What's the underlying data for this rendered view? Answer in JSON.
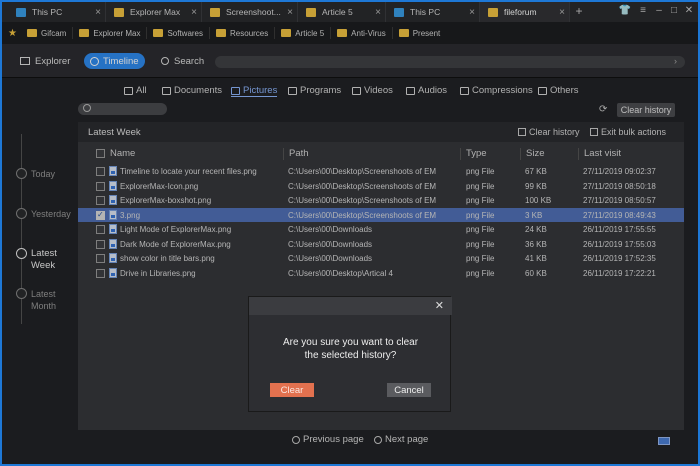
{
  "tabs": [
    {
      "label": "This PC",
      "icon": "pc-icon",
      "active": false
    },
    {
      "label": "Explorer Max",
      "icon": "folder-icon",
      "active": false
    },
    {
      "label": "Screenshoot...",
      "icon": "folder-icon",
      "active": false
    },
    {
      "label": "Article 5",
      "icon": "folder-icon",
      "active": false
    },
    {
      "label": "This PC",
      "icon": "pc-icon",
      "active": false
    },
    {
      "label": "fileforum",
      "icon": "folder-icon",
      "active": true
    }
  ],
  "tab_close": "×",
  "tab_add": "+",
  "window_controls": {
    "skin": "👕",
    "menu": "≡",
    "minimize": "–",
    "maximize": "□",
    "close": "✕"
  },
  "bookmarks": [
    "Gifcam",
    "Explorer Max",
    "Softwares",
    "Resources",
    "Article 5",
    "Anti-Virus",
    "Present"
  ],
  "nav": {
    "explorer": "Explorer",
    "timeline": "Timeline",
    "search": "Search"
  },
  "timeline": {
    "items": [
      {
        "label": "Today",
        "selected": false
      },
      {
        "label": "Yesterday",
        "selected": false
      },
      {
        "label": "Latest Week",
        "selected": true
      },
      {
        "label": "Latest Month",
        "selected": false
      }
    ]
  },
  "categories": [
    "All",
    "Documents",
    "Pictures",
    "Programs",
    "Videos",
    "Audios",
    "Compressions",
    "Others"
  ],
  "active_category": "Pictures",
  "toolbar": {
    "clear_history": "Clear history"
  },
  "panel": {
    "title": "Latest Week",
    "clear_history": "Clear history",
    "exit_bulk": "Exit bulk actions",
    "columns": {
      "name": "Name",
      "path": "Path",
      "type": "Type",
      "size": "Size",
      "last_visit": "Last visit"
    },
    "rows": [
      {
        "name": "Timeline to locate your recent files.png",
        "path": "C:\\Users\\00\\Desktop\\Screenshoots of EM",
        "type": "png File",
        "size": "67 KB",
        "last_visit": "27/11/2019 09:02:37",
        "checked": false,
        "selected": false
      },
      {
        "name": "ExplorerMax-Icon.png",
        "path": "C:\\Users\\00\\Desktop\\Screenshoots of EM",
        "type": "png File",
        "size": "99 KB",
        "last_visit": "27/11/2019 08:50:18",
        "checked": false,
        "selected": false
      },
      {
        "name": "ExplorerMax-boxshot.png",
        "path": "C:\\Users\\00\\Desktop\\Screenshoots of EM",
        "type": "png File",
        "size": "100 KB",
        "last_visit": "27/11/2019 08:50:57",
        "checked": false,
        "selected": false
      },
      {
        "name": "3.png",
        "path": "C:\\Users\\00\\Desktop\\Screenshoots of EM",
        "type": "png File",
        "size": "3 KB",
        "last_visit": "27/11/2019 08:49:43",
        "checked": true,
        "selected": true
      },
      {
        "name": "Light Mode of ExplorerMax.png",
        "path": "C:\\Users\\00\\Downloads",
        "type": "png File",
        "size": "24 KB",
        "last_visit": "26/11/2019 17:55:55",
        "checked": false,
        "selected": false
      },
      {
        "name": "Dark Mode of ExplorerMax.png",
        "path": "C:\\Users\\00\\Downloads",
        "type": "png File",
        "size": "36 KB",
        "last_visit": "26/11/2019 17:55:03",
        "checked": false,
        "selected": false
      },
      {
        "name": "show color in title bars.png",
        "path": "C:\\Users\\00\\Downloads",
        "type": "png File",
        "size": "41 KB",
        "last_visit": "26/11/2019 17:52:35",
        "checked": false,
        "selected": false
      },
      {
        "name": "Drive in Libraries.png",
        "path": "C:\\Users\\00\\Desktop\\Artical 4",
        "type": "png File",
        "size": "60 KB",
        "last_visit": "26/11/2019 17:22:21",
        "checked": false,
        "selected": false
      }
    ]
  },
  "dialog": {
    "close": "✕",
    "message_line1": "Are you sure you want to clear",
    "message_line2": "the selected history?",
    "confirm": "Clear",
    "cancel": "Cancel"
  },
  "pager": {
    "previous": "Previous page",
    "next": "Next page"
  },
  "colors": {
    "accent": "#2f8cf0",
    "selected_row": "#5171b8",
    "danger": "#e2714f",
    "frame": "#1e78d6"
  }
}
